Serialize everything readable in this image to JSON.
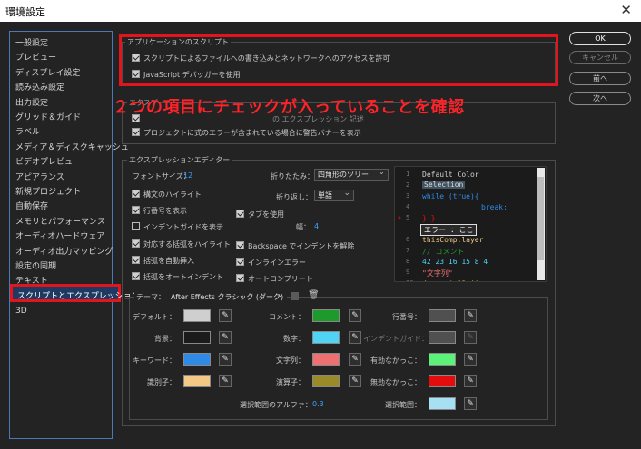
{
  "window": {
    "title": "環境設定",
    "close": "✕"
  },
  "sidebar": {
    "items": [
      "一般設定",
      "プレビュー",
      "ディスプレイ設定",
      "読み込み設定",
      "出力設定",
      "グリッド＆ガイド",
      "ラベル",
      "メディア＆ディスクキャッシュ",
      "ビデオプレビュー",
      "アピアランス",
      "新規プロジェクト",
      "自動保存",
      "メモリとパフォーマンス",
      "オーディオハードウェア",
      "オーディオ出力マッピング",
      "設定の同期",
      "テキスト"
    ],
    "selected": "スクリプトとエクスプレッション",
    "after": "3D"
  },
  "buttons": {
    "ok": "OK",
    "cancel": "キャンセル",
    "prev": "前へ",
    "next": "次へ"
  },
  "app_scripts": {
    "legend": "アプリケーションのスクリプト",
    "allow_network": "スクリプトによるファイルへの書き込みとネットワークへのアクセスを許可",
    "js_debugger": "JavaScript デバッガーを使用"
  },
  "callout": "２つの項目にチェックが入っていることを確認",
  "expr_section": {
    "legend_partial": "エクスプ",
    "item1_partial": "の エクスプレッション 記述",
    "item2": "プロジェクトに式のエラーが含まれている場合に警告バナーを表示"
  },
  "editor": {
    "legend": "エクスプレッションエディター",
    "font_size_label": "フォントサイズ：",
    "font_size": "12",
    "fold_label": "折りたたみ：",
    "fold_value": "四角形のツリー",
    "wrap_label": "折り返し：",
    "wrap_value": "単語",
    "syntax_highlight": "構文のハイライト",
    "line_numbers": "行番号を表示",
    "use_tabs": "タブを使用",
    "indent_guides": "インデントガイドを表示",
    "width_label": "幅：",
    "width": "4",
    "highlight_brackets": "対応する括弧をハイライト",
    "backspace_unindent": "Backspace でインデントを解除",
    "auto_insert_brackets": "括弧を自動挿入",
    "inline_errors": "インラインエラー",
    "auto_indent_brackets": "括弧をオートインデント",
    "autocomplete": "オートコンプリート"
  },
  "code": {
    "lines": [
      "1",
      "2",
      "3",
      "4",
      "5",
      "",
      "6",
      "7",
      "8",
      "9",
      "10"
    ],
    "l1": "Default Color",
    "l2": "Selection",
    "l3": "while (true){",
    "l4": "break;",
    "l5": "} }",
    "l5err": "エラー : ここ",
    "l6": "thisComp.layer",
    "l7": "// コメント",
    "l8": "42 23 16 15 8 4",
    "l9": "\"文字列\"",
    "l10": "/ + - * && ||"
  },
  "theme": {
    "label": "テーマ：",
    "value": "After Effects クラシック (ダーク)",
    "rows": [
      [
        {
          "label": "デフォルト：",
          "color": "#cfcfcf"
        },
        {
          "label": "コメント：",
          "color": "#1e9a2d"
        },
        {
          "label": "行番号：",
          "color": "#505050"
        }
      ],
      [
        {
          "label": "背景：",
          "color": "#1b1b1b"
        },
        {
          "label": "数字：",
          "color": "#4fd4f5"
        },
        {
          "label": "インデントガイド：",
          "color": "#505050",
          "disabled": true
        }
      ],
      [
        {
          "label": "キーワード：",
          "color": "#2f8ae6"
        },
        {
          "label": "文字列：",
          "color": "#ef7070"
        },
        {
          "label": "有効なかっこ：",
          "color": "#5cf27a"
        }
      ],
      [
        {
          "label": "識別子：",
          "color": "#f3c985"
        },
        {
          "label": "演算子：",
          "color": "#9a8a28"
        },
        {
          "label": "無効なかっこ：",
          "color": "#e40d0d"
        }
      ]
    ],
    "sel_alpha_label": "選択範囲のアルファ：",
    "sel_alpha": "0.3",
    "sel_range_label": "選択範囲：",
    "sel_range_color": "#a6e0f2"
  },
  "colors": {
    "accent_red": "#e4141c",
    "link_blue": "#3fa2ff"
  }
}
